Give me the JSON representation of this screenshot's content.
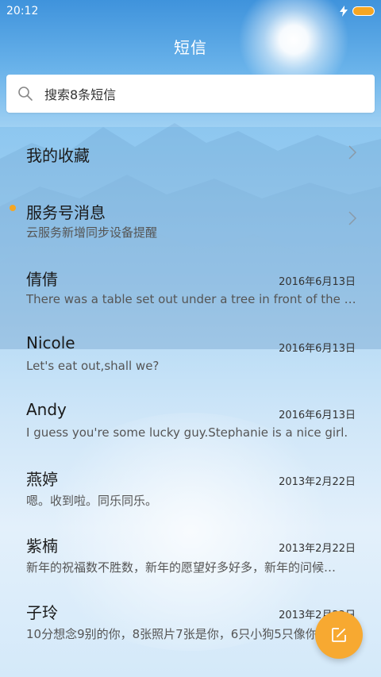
{
  "status_bar": {
    "time": "20:12"
  },
  "header": {
    "title": "短信"
  },
  "search": {
    "placeholder": "搜索8条短信"
  },
  "items": [
    {
      "name": "我的收藏",
      "type": "folder"
    },
    {
      "name": "服务号消息",
      "preview": "云服务新增同步设备提醒",
      "type": "folder",
      "unread": true
    },
    {
      "name": "倩倩",
      "date": "2016年6月13日",
      "preview": "There was a table set out under a tree in front of the ho…"
    },
    {
      "name": "Nicole",
      "date": "2016年6月13日",
      "preview": "Let's eat out,shall we?"
    },
    {
      "name": "Andy",
      "date": "2016年6月13日",
      "preview": "I guess you're some lucky guy.Stephanie is a nice girl."
    },
    {
      "name": "燕婷",
      "date": "2013年2月22日",
      "preview": "嗯。收到啦。同乐同乐。"
    },
    {
      "name": "紫楠",
      "date": "2013年2月22日",
      "preview": "新年的祝福数不胜数，新年的愿望好多好多，新年的问候…"
    },
    {
      "name": "子玲",
      "date": "2013年2月22日",
      "preview": "10分想念9别的你，8张照片7张是你，6只小狗5只像你…"
    }
  ],
  "colors": {
    "accent": "#f5a623",
    "fab": "#f7a931"
  },
  "icons": {
    "search": "search-icon",
    "compose": "compose-icon",
    "chevron": "chevron-right-icon"
  }
}
